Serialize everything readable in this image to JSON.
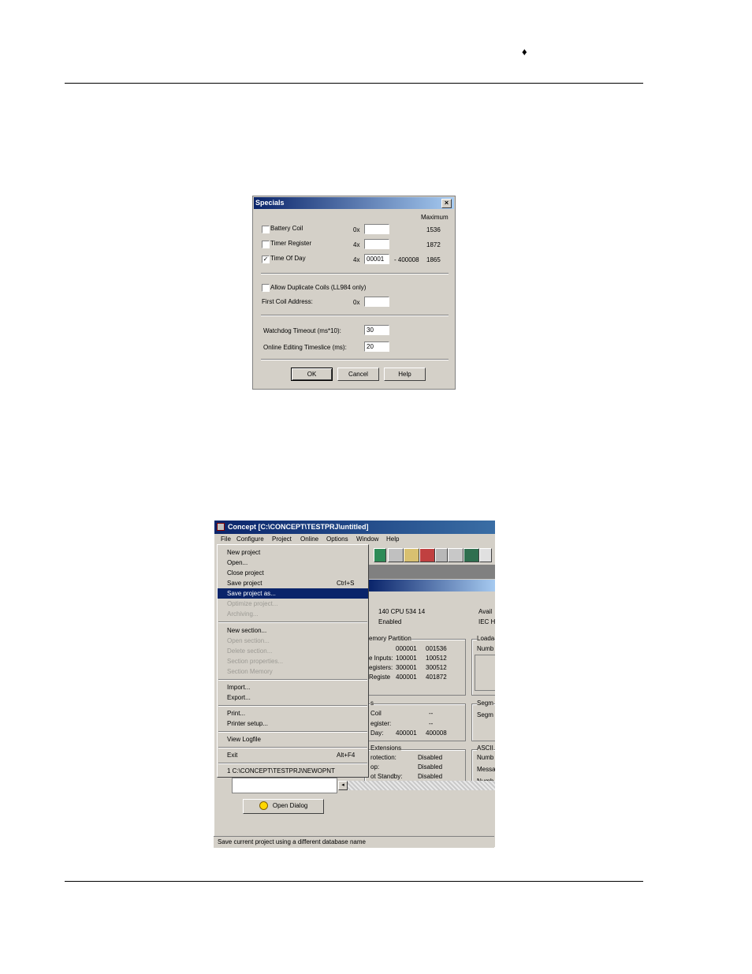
{
  "header": {
    "bullet": "♦"
  },
  "specials": {
    "title": "Specials",
    "close": "×",
    "maximum_header": "Maximum",
    "rows": [
      {
        "label": "Battery Coil",
        "prefix": "0x",
        "value": "",
        "range": "",
        "max": "1536",
        "checked": false
      },
      {
        "label": "Timer Register",
        "prefix": "4x",
        "value": "",
        "range": "",
        "max": "1872",
        "checked": false
      },
      {
        "label": "Time Of Day",
        "prefix": "4x",
        "value": "00001",
        "range": "- 400008",
        "max": "1865",
        "checked": true
      }
    ],
    "allow_duplicate": "Allow Duplicate Coils (LL984 only)",
    "first_coil_label": "First Coil Address:",
    "first_coil_prefix": "0x",
    "first_coil_value": "",
    "watchdog_label": "Watchdog Timeout (ms*10):",
    "watchdog_value": "30",
    "timeslice_label": "Online Editing Timeslice (ms):",
    "timeslice_value": "20",
    "buttons": {
      "ok": "OK",
      "cancel": "Cancel",
      "help": "Help"
    }
  },
  "concept": {
    "title": "Concept [C:\\CONCEPT\\TESTPRJ\\untitled]",
    "menu": [
      "File",
      "Configure",
      "Project",
      "Online",
      "Options",
      "Window",
      "Help"
    ],
    "file_menu": [
      {
        "label": "New project",
        "shortcut": "",
        "state": "normal"
      },
      {
        "label": "Open...",
        "shortcut": "",
        "state": "normal"
      },
      {
        "label": "Close project",
        "shortcut": "",
        "state": "normal"
      },
      {
        "label": "Save project",
        "shortcut": "Ctrl+S",
        "state": "normal"
      },
      {
        "label": "Save project as...",
        "shortcut": "",
        "state": "selected"
      },
      {
        "label": "Optimize project...",
        "shortcut": "",
        "state": "disabled"
      },
      {
        "label": "Archiving...",
        "shortcut": "",
        "state": "disabled"
      },
      {
        "label": "New section...",
        "shortcut": "",
        "state": "normal"
      },
      {
        "label": "Open section...",
        "shortcut": "",
        "state": "disabled"
      },
      {
        "label": "Delete section...",
        "shortcut": "",
        "state": "disabled"
      },
      {
        "label": "Section properties...",
        "shortcut": "",
        "state": "disabled"
      },
      {
        "label": "Section Memory",
        "shortcut": "",
        "state": "disabled"
      },
      {
        "label": "Import...",
        "shortcut": "",
        "state": "normal"
      },
      {
        "label": "Export...",
        "shortcut": "",
        "state": "normal"
      },
      {
        "label": "Print...",
        "shortcut": "",
        "state": "normal"
      },
      {
        "label": "Printer setup...",
        "shortcut": "",
        "state": "normal"
      },
      {
        "label": "View Logfile",
        "shortcut": "",
        "state": "normal"
      },
      {
        "label": "Exit",
        "shortcut": "Alt+F4",
        "state": "normal"
      },
      {
        "label": "1 C:\\CONCEPT\\TESTPRJ\\NEWOPNT",
        "shortcut": "",
        "state": "normal"
      }
    ],
    "cpu": "140 CPU 534 14",
    "enabled": "Enabled",
    "avail": "Avail",
    "iec": "IEC H",
    "memory_partition": {
      "title": "emory Partition",
      "rows": [
        {
          "label": "",
          "a": "000001",
          "b": "001536"
        },
        {
          "label": "e Inputs:",
          "a": "100001",
          "b": "100512"
        },
        {
          "label": "egisters:",
          "a": "300001",
          "b": "300512"
        },
        {
          "label": "Registe",
          "a": "400001",
          "b": "401872"
        }
      ]
    },
    "specials_box": {
      "title": "s",
      "rows": [
        {
          "label": "Coil",
          "a": "",
          "b": "--"
        },
        {
          "label": "egister:",
          "a": "",
          "b": "--"
        },
        {
          "label": "Day:",
          "a": "400001",
          "b": "400008"
        }
      ]
    },
    "extensions": {
      "title": "Extensions",
      "rows": [
        {
          "label": "rotection:",
          "value": "Disabled"
        },
        {
          "label": "op:",
          "value": "Disabled"
        },
        {
          "label": "ot Standby:",
          "value": "Disabled"
        }
      ]
    },
    "loadable": {
      "title": "Loada",
      "sub": "Numb"
    },
    "segment": {
      "title": "Segm",
      "sub": "Segm"
    },
    "ascii": {
      "title": "ASCII",
      "sub1": "Numb",
      "sub2": "Messa",
      "sub3": "Numb"
    },
    "open_dialog": "Open Dialog",
    "status": "Save current project using a different database name"
  }
}
